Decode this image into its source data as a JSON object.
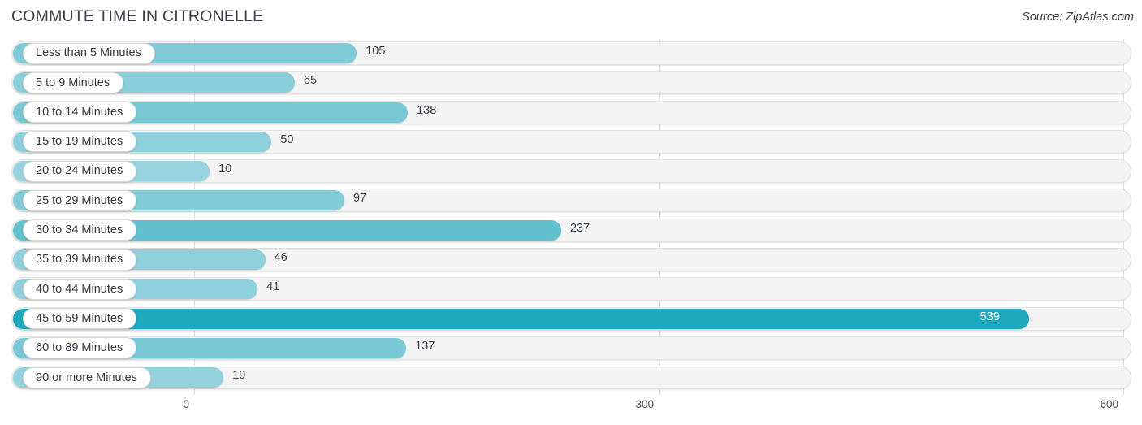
{
  "header": {
    "title": "COMMUTE TIME IN CITRONELLE",
    "source": "Source: ZipAtlas.com"
  },
  "colors": {
    "bar_min": "#96d3de",
    "bar_max": "#1fa7bc",
    "track_fill": "#f4f4f4",
    "track_border": "#e3e3e3",
    "gridline": "#dcdcdc",
    "text": "#3c4046",
    "value_inside": "#ffffff"
  },
  "chart_data": {
    "type": "bar",
    "orientation": "horizontal",
    "title": "COMMUTE TIME IN CITRONELLE",
    "xlabel": "",
    "ylabel": "",
    "xlim": [
      0,
      600
    ],
    "ticks": [
      "0",
      "300",
      "600"
    ],
    "tick_values": [
      0,
      300,
      600
    ],
    "grid": true,
    "legend": false,
    "categories": [
      "Less than 5 Minutes",
      "5 to 9 Minutes",
      "10 to 14 Minutes",
      "15 to 19 Minutes",
      "20 to 24 Minutes",
      "25 to 29 Minutes",
      "30 to 34 Minutes",
      "35 to 39 Minutes",
      "40 to 44 Minutes",
      "45 to 59 Minutes",
      "60 to 89 Minutes",
      "90 or more Minutes"
    ],
    "values": [
      105,
      65,
      138,
      50,
      10,
      97,
      237,
      46,
      41,
      539,
      137,
      19
    ],
    "value_labels": [
      "105",
      "65",
      "138",
      "50",
      "10",
      "97",
      "237",
      "46",
      "41",
      "539",
      "137",
      "19"
    ]
  }
}
